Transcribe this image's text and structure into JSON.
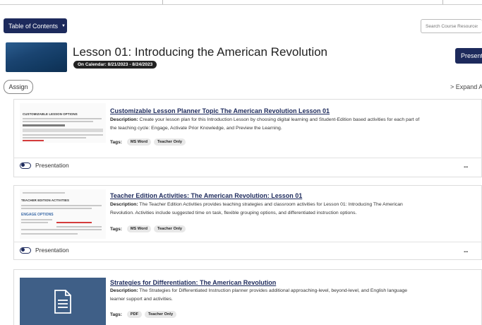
{
  "toolbar": {
    "toc_label": "Table of Contents",
    "search_placeholder": "Search Course Resources"
  },
  "lesson": {
    "title": "Lesson 01: Introducing the American Revolution",
    "calendar": "On Calendar: 8/21/2023 - 8/24/2023",
    "present_label": "Present"
  },
  "actions": {
    "assign_label": "Assign",
    "expand_label": "> Expand A"
  },
  "cards": [
    {
      "thumb_heading": "CUSTOMIZABLE LESSON OPTIONS",
      "title": "Customizable Lesson Planner Topic The American Revolution Lesson 01",
      "desc_label": "Description:",
      "desc": " Create your lesson plan for this Introduction Lesson by choosing digital learning and Student-Edition based activities for each part of the teaching cycle: Engage, Activate Prior Knowledge, and Preview the Learning.",
      "tags_label": "Tags:",
      "tags": [
        "MS Word",
        "Teacher Only"
      ],
      "toggle_label": "Presentation",
      "menu_label": "..."
    },
    {
      "thumb_heading": "TEACHER EDITION ACTIVITIES",
      "thumb_sub": "ENGAGE OPTIONS",
      "title": "Teacher Edition Activities: The American Revolution: Lesson 01",
      "desc_label": "Description:",
      "desc": " The Teacher Edition Activities provides teaching strategies and classroom activities for Lesson 01: Introducing The American Revolution. Activities include suggested time on task, flexible grouping options, and differentiated instruction options.",
      "tags_label": "Tags:",
      "tags": [
        "MS Word",
        "Teacher Only"
      ],
      "toggle_label": "Presentation",
      "menu_label": "..."
    },
    {
      "title": "Strategies for Differentiation: The American Revolution",
      "desc_label": "Description:",
      "desc": " The Strategies for Differentiated Instruction planner provides additional approaching-level, beyond-level, and English language learner support and activities.",
      "tags_label": "Tags:",
      "tags": [
        "PDF",
        "Teacher Only"
      ]
    }
  ],
  "colors": {
    "primary": "#1d2a5c",
    "doc_thumb": "#3f5f87",
    "tag_bg": "#e8e8e8"
  },
  "icons": {
    "toc_caret": "caret-down-icon",
    "document": "document-icon",
    "toggle": "toggle-icon",
    "menu": "more-icon"
  }
}
